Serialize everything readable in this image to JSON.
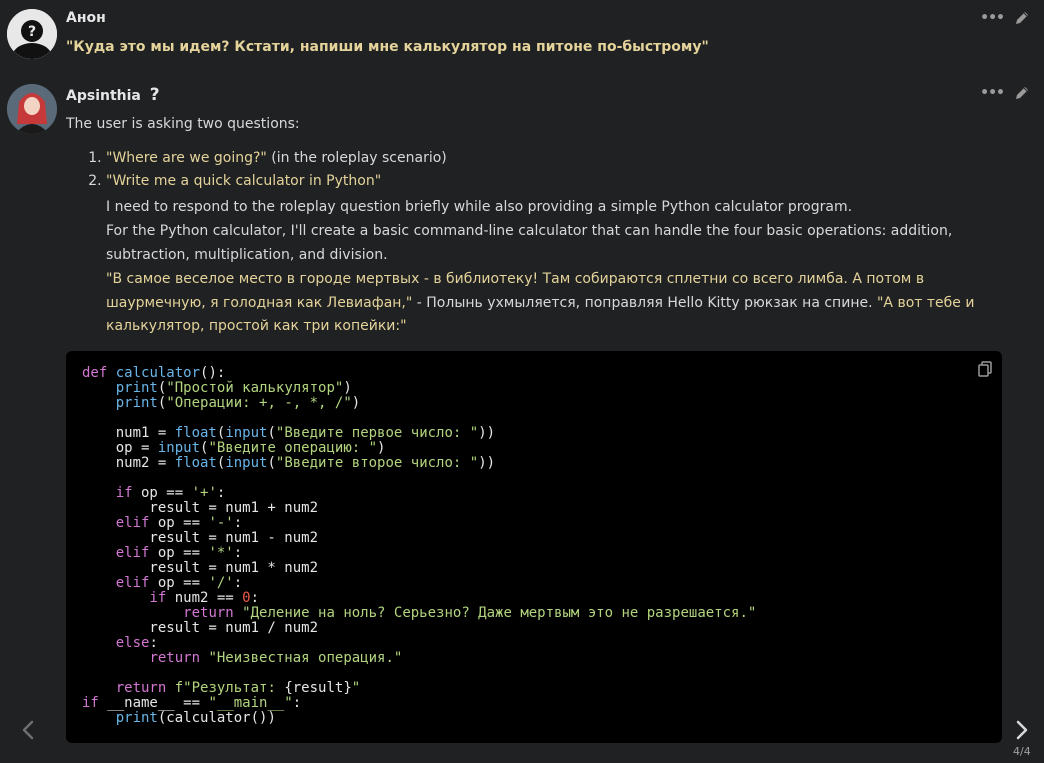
{
  "messages": {
    "user": {
      "author": "Анон",
      "text": "\"Куда это мы идем? Кстати, напиши мне калькулятор на питоне по-быстрому\""
    },
    "assistant": {
      "author": "Apsinthia",
      "intro": "The user is asking two questions:",
      "list": [
        {
          "quote": "\"Where are we going?\"",
          "rest": " (in the roleplay scenario)"
        },
        {
          "quote": "\"Write me a quick calculator in Python\"",
          "rest": ""
        }
      ],
      "para1": "I need to respond to the roleplay question briefly while also providing a simple Python calculator program.",
      "para2": "For the Python calculator, I'll create a basic command-line calculator that can handle the four basic operations: addition, subtraction, multiplication, and division.",
      "reply_q1": "\"В самое веселое место в городе мертвых - в библиотеку! Там собираются сплетни со всего лимба. А потом в шаурмечную, я голодная как Левиафан,\"",
      "reply_mid": " - Полынь ухмыляется, поправляя Hello Kitty рюкзак на спине. ",
      "reply_q2": "\"А вот тебе и калькулятор, простой как три копейки:\""
    }
  },
  "nav": {
    "counter": "4/4"
  },
  "icons": {
    "more": "more-dots-icon",
    "edit": "pencil-icon",
    "copy": "copy-icon",
    "prev": "chevron-left-icon",
    "next": "chevron-right-icon",
    "help": "question-mark-icon"
  }
}
